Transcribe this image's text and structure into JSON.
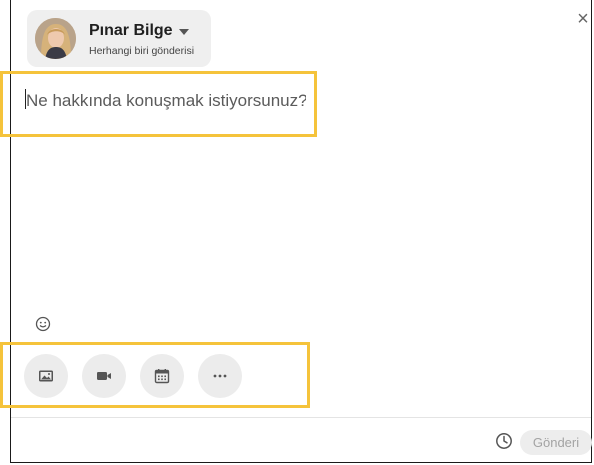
{
  "author": {
    "name": "Pınar Bilge",
    "visibility": "Herhangi biri gönderisi"
  },
  "composer": {
    "placeholder": "Ne hakkında konuşmak istiyorsunuz?",
    "value": ""
  },
  "close_symbol": "×",
  "toolbar": {
    "items": [
      {
        "name": "photo",
        "icon": "image-icon"
      },
      {
        "name": "video",
        "icon": "video-camera-icon"
      },
      {
        "name": "event",
        "icon": "calendar-icon"
      },
      {
        "name": "more",
        "icon": "more-horizontal-icon"
      }
    ]
  },
  "footer": {
    "post_label": "Gönderi",
    "schedule_icon": "clock-icon"
  },
  "colors": {
    "highlight": "#f5c33b",
    "chip_background": "#efefef",
    "button_background": "#ececec",
    "disabled_text": "#a3a3a3"
  }
}
